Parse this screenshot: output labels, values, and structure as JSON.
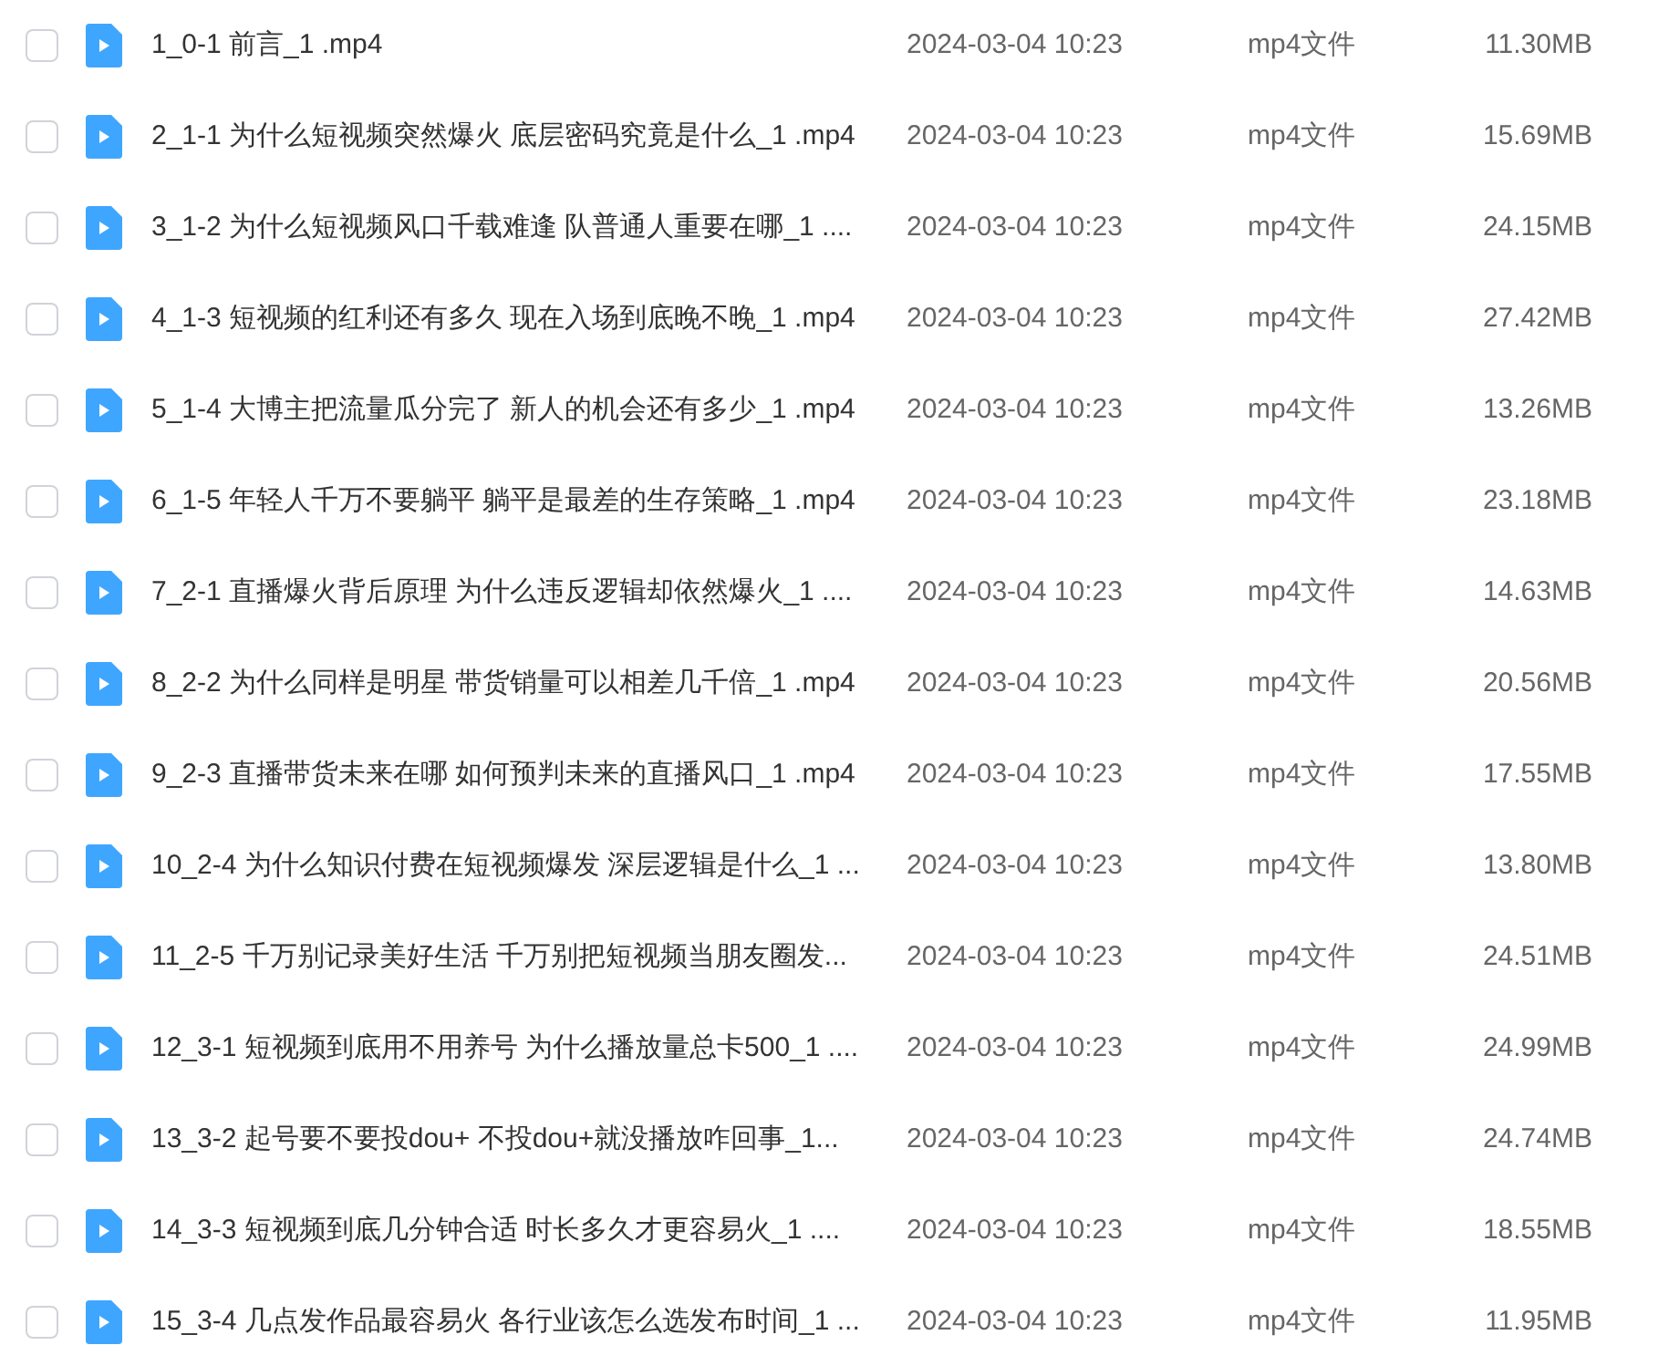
{
  "files": [
    {
      "selected": false,
      "name": "1_0-1 前言_1 .mp4",
      "modified": "2024-03-04 10:23",
      "type": "mp4文件",
      "size": "11.30MB"
    },
    {
      "selected": false,
      "name": "2_1-1 为什么短视频突然爆火 底层密码究竟是什么_1 .mp4",
      "modified": "2024-03-04 10:23",
      "type": "mp4文件",
      "size": "15.69MB"
    },
    {
      "selected": false,
      "name": "3_1-2 为什么短视频风口千载难逢 队普通人重要在哪_1 ....",
      "modified": "2024-03-04 10:23",
      "type": "mp4文件",
      "size": "24.15MB"
    },
    {
      "selected": false,
      "name": "4_1-3 短视频的红利还有多久 现在入场到底晚不晚_1 .mp4",
      "modified": "2024-03-04 10:23",
      "type": "mp4文件",
      "size": "27.42MB"
    },
    {
      "selected": false,
      "name": "5_1-4 大博主把流量瓜分完了 新人的机会还有多少_1 .mp4",
      "modified": "2024-03-04 10:23",
      "type": "mp4文件",
      "size": "13.26MB"
    },
    {
      "selected": false,
      "name": "6_1-5 年轻人千万不要躺平 躺平是最差的生存策略_1 .mp4",
      "modified": "2024-03-04 10:23",
      "type": "mp4文件",
      "size": "23.18MB"
    },
    {
      "selected": false,
      "name": "7_2-1 直播爆火背后原理 为什么违反逻辑却依然爆火_1 ....",
      "modified": "2024-03-04 10:23",
      "type": "mp4文件",
      "size": "14.63MB"
    },
    {
      "selected": false,
      "name": "8_2-2 为什么同样是明星 带货销量可以相差几千倍_1 .mp4",
      "modified": "2024-03-04 10:23",
      "type": "mp4文件",
      "size": "20.56MB"
    },
    {
      "selected": false,
      "name": "9_2-3 直播带货未来在哪 如何预判未来的直播风口_1 .mp4",
      "modified": "2024-03-04 10:23",
      "type": "mp4文件",
      "size": "17.55MB"
    },
    {
      "selected": false,
      "name": "10_2-4 为什么知识付费在短视频爆发 深层逻辑是什么_1 ...",
      "modified": "2024-03-04 10:23",
      "type": "mp4文件",
      "size": "13.80MB"
    },
    {
      "selected": false,
      "name": "11_2-5 千万别记录美好生活 千万别把短视频当朋友圈发...",
      "modified": "2024-03-04 10:23",
      "type": "mp4文件",
      "size": "24.51MB"
    },
    {
      "selected": false,
      "name": "12_3-1 短视频到底用不用养号 为什么播放量总卡500_1 ....",
      "modified": "2024-03-04 10:23",
      "type": "mp4文件",
      "size": "24.99MB"
    },
    {
      "selected": false,
      "name": "13_3-2 起号要不要投dou+ 不投dou+就没播放咋回事_1...",
      "modified": "2024-03-04 10:23",
      "type": "mp4文件",
      "size": "24.74MB"
    },
    {
      "selected": false,
      "name": "14_3-3 短视频到底几分钟合适 时长多久才更容易火_1 ....",
      "modified": "2024-03-04 10:23",
      "type": "mp4文件",
      "size": "18.55MB"
    },
    {
      "selected": false,
      "name": "15_3-4 几点发作品最容易火 各行业该怎么选发布时间_1 ...",
      "modified": "2024-03-04 10:23",
      "type": "mp4文件",
      "size": "11.95MB"
    }
  ]
}
